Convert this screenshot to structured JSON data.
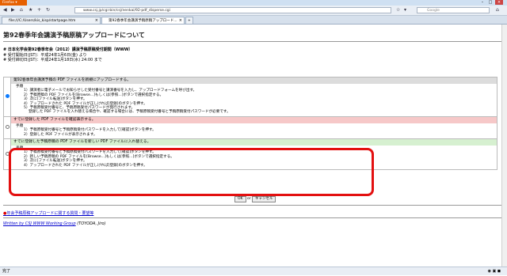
{
  "browser": {
    "app_button": "Firefox ▾",
    "back": "◀",
    "forward": "▶",
    "home": "⌂",
    "bookmark": "★",
    "add": "+",
    "reload": "↻",
    "url": "www.csj.jp/cgi-bin/csj/nenkai/92-pdf_disperse.cgi",
    "search_placeholder": "Google",
    "tabs": [
      {
        "label": "file:///C:/Users/kis_kisp/startpage.htm"
      },
      {
        "label": "第92春季年会講演予稿原稿アップロード..."
      }
    ],
    "new_tab": "+",
    "status": "完了"
  },
  "page": {
    "title": "第92春季年会講演予稿原稿アップロードについて",
    "meeting": "# 日本化学会第92春季年会（2012）講演予稿原稿受付期間（WWW）",
    "start": "# 受付開始日(JST)：平成24年1月6日(金) より",
    "end": "# 受付締切日(JST)：平成24年1月18日(水) 24:00 まで",
    "options": [
      {
        "header": "第92春季年会講演予稿の PDF ファイルを新規にアップロードする。",
        "steps_title": "手順",
        "steps": [
          "1）講演者に電子メールでお知らせした受付番号と講演番号を入力し、アップロードフォームを呼び出す。",
          "2）予稿原稿の PDF ファイルを[Browse...]もしくは[参照...]ボタンで選択指定する。",
          "3）次に[ファイル転送]ボタンを押す。",
          "4）アップロードされた PDF ファイルが正しければ[登録]のボタンを押す。",
          "5）予稿原稿受付番号と、予稿原稿受付パスワードが発行されます。",
          "　 登録した PDF ファイルを入れ替える場合や、確認する場合には、予稿原稿受付番号と予稿原稿受付パスワードが必要です。"
        ]
      },
      {
        "header": "すでに登録した PDF ファイルを確認表示する。",
        "steps_title": "手順",
        "steps": [
          "1）予稿原稿受付番号と予稿原稿受付パスワードを入力して[確認]ボタンを押す。",
          "2）登録した PDF ファイルが表示されます。"
        ]
      },
      {
        "header": "すでに登録した予稿原稿の PDF ファイルを新しい PDF ファイルに入れ替える。",
        "steps_title": "手順",
        "steps": [
          "1）予稿原稿受付番号と予稿原稿受付パスワードを入力して[確認]ボタンを押す。",
          "2）新しい予稿原稿の PDF ファイルを[Browse...]もしくは[参照...]ボタンで選択指定する。",
          "3）次に[ファイル転送]ボタンを押す。",
          "4）アップロードされた PDF ファイルが正しければ[登録]のボタンを押す。"
        ]
      }
    ],
    "ok_label": "OK",
    "or_label": "or",
    "cancel_label": "キャンセル",
    "faq_link": "年会予稿原稿アップロードに関する質問・要望等",
    "footer_link": "Written by CSJ WWW Working Group",
    "footer_author": "(TOYODA, Jiro)"
  }
}
